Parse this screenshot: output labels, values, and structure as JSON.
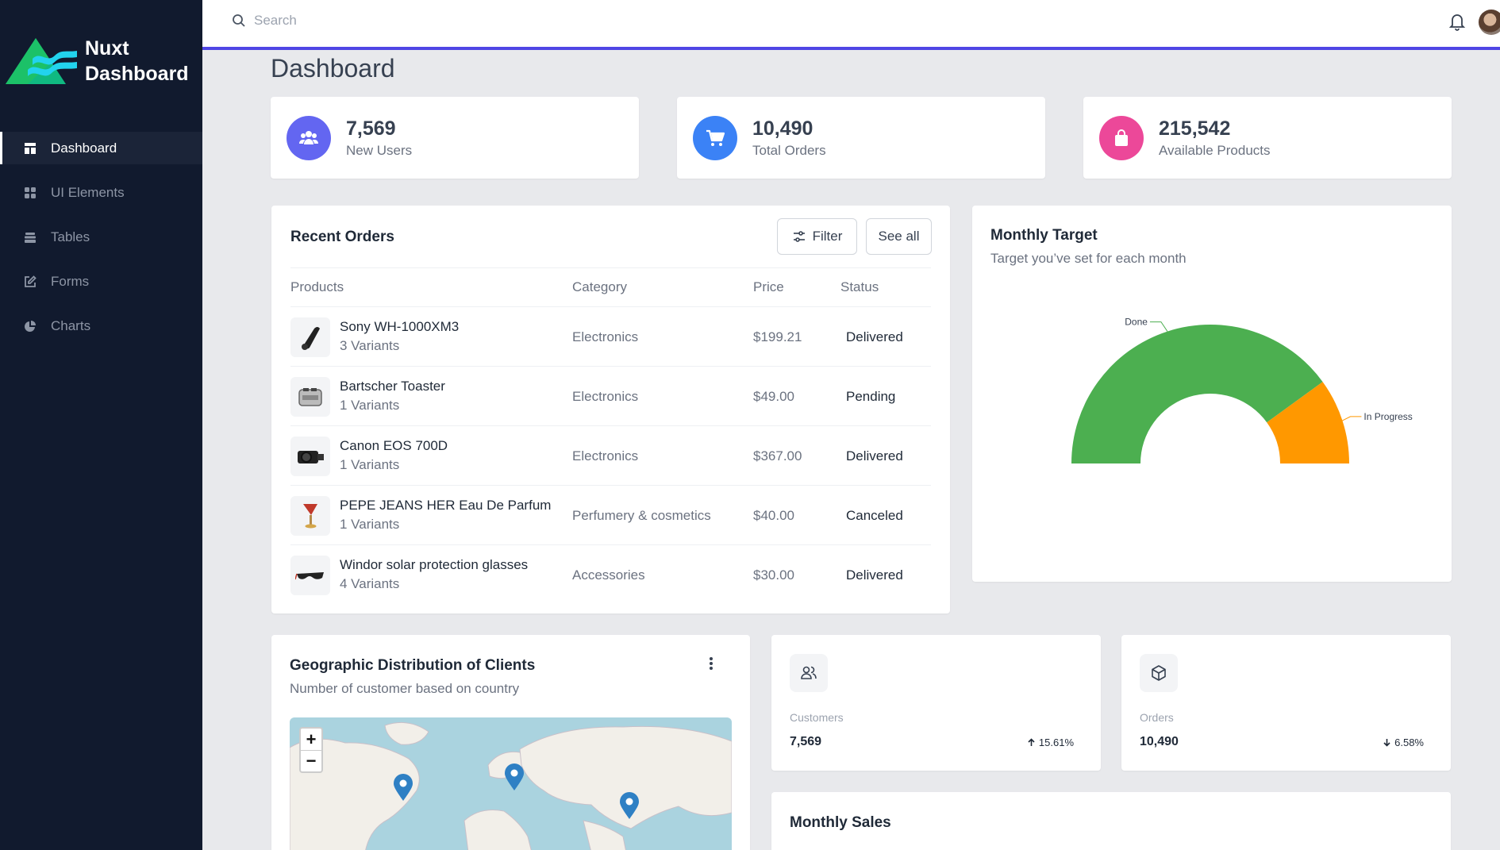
{
  "brand": {
    "line1": "Nuxt",
    "line2": "Dashboard"
  },
  "sidebar": {
    "items": [
      {
        "label": "Dashboard",
        "icon": "dashboard-icon",
        "active": true
      },
      {
        "label": "UI Elements",
        "icon": "grid-icon"
      },
      {
        "label": "Tables",
        "icon": "table-icon"
      },
      {
        "label": "Forms",
        "icon": "edit-icon"
      },
      {
        "label": "Charts",
        "icon": "pie-chart-icon"
      }
    ]
  },
  "topbar": {
    "search_placeholder": "Search",
    "accent": "#4f46e5"
  },
  "page": {
    "title": "Dashboard"
  },
  "stats": [
    {
      "value": "7,569",
      "label": "New Users",
      "color": "#6366f1",
      "icon": "users-icon"
    },
    {
      "value": "10,490",
      "label": "Total Orders",
      "color": "#3b82f6",
      "icon": "cart-icon"
    },
    {
      "value": "215,542",
      "label": "Available Products",
      "color": "#ec4899",
      "icon": "bag-icon"
    }
  ],
  "recent_orders": {
    "title": "Recent Orders",
    "filter_label": "Filter",
    "see_all_label": "See all",
    "columns": [
      "Products",
      "Category",
      "Price",
      "Status"
    ],
    "rows": [
      {
        "name": "Sony WH-1000XM3",
        "variants": "3 Variants",
        "category": "Electronics",
        "price": "$199.21",
        "status": "Delivered"
      },
      {
        "name": "Bartscher Toaster",
        "variants": "1 Variants",
        "category": "Electronics",
        "price": "$49.00",
        "status": "Pending"
      },
      {
        "name": "Canon EOS 700D",
        "variants": "1 Variants",
        "category": "Electronics",
        "price": "$367.00",
        "status": "Delivered"
      },
      {
        "name": "PEPE JEANS HER Eau De Parfum",
        "variants": "1 Variants",
        "category": "Perfumery & cosmetics",
        "price": "$40.00",
        "status": "Canceled"
      },
      {
        "name": "Windor solar protection glasses",
        "variants": "4 Variants",
        "category": "Accessories",
        "price": "$30.00",
        "status": "Delivered"
      }
    ]
  },
  "monthly_target": {
    "title": "Monthly Target",
    "subtitle": "Target you’ve set for each month",
    "done_label": "Done",
    "in_progress_label": "In Progress",
    "done_color": "#4caf50",
    "progress_color": "#ff9800",
    "done_fraction": 0.8
  },
  "geo": {
    "title": "Geographic Distribution of Clients",
    "subtitle": "Number of customer based on country",
    "zoom_in": "+",
    "zoom_out": "−"
  },
  "kpis": [
    {
      "label": "Customers",
      "value": "7,569",
      "change": "15.61%",
      "direction": "up",
      "icon": "users-outline-icon"
    },
    {
      "label": "Orders",
      "value": "10,490",
      "change": "6.58%",
      "direction": "down",
      "icon": "box-icon"
    }
  ],
  "monthly_sales": {
    "title": "Monthly Sales"
  }
}
